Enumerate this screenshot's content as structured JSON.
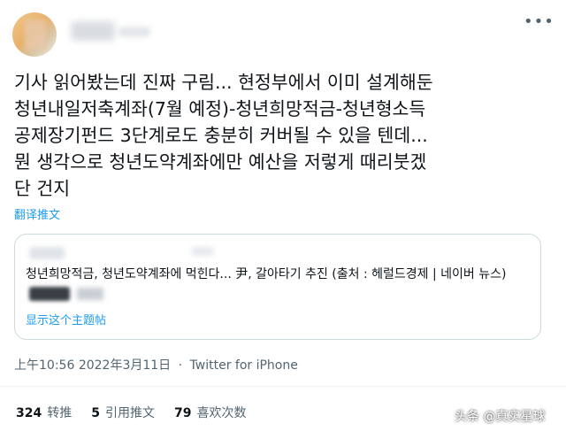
{
  "header": {
    "more_icon": "more-icon"
  },
  "tweet": {
    "text_line1": "기사 읽어봤는데 진짜 구림... 현정부에서 이미 설계해둔",
    "text_line2": "청년내일저축계좌(7월 예정)-청년희망적금-청년형소득",
    "text_line3": "공제장기펀드 3단계로도 충분히 커버될 수 있을 텐데...",
    "text_line4": "뭔 생각으로 청년도약계좌에만 예산을 저렇게 때리붓겠",
    "text_line5": "단 건지",
    "translate_label": "翻译推文"
  },
  "quoted": {
    "text": "청년희망적금, 청년도약계좌에 먹힌다... 尹, 갈아타기 추진 (출처 : 헤럴드경제 | 네이버 뉴스)",
    "show_thread_label": "显示这个主题帖"
  },
  "meta": {
    "time": "上午10:56",
    "date": "2022年3月11日",
    "separator": "·",
    "source": "Twitter for iPhone"
  },
  "stats": [
    {
      "count": "324",
      "label": "转推"
    },
    {
      "count": "5",
      "label": "引用推文"
    },
    {
      "count": "79",
      "label": "喜欢次数"
    }
  ],
  "watermark": "头条 @真实星球"
}
